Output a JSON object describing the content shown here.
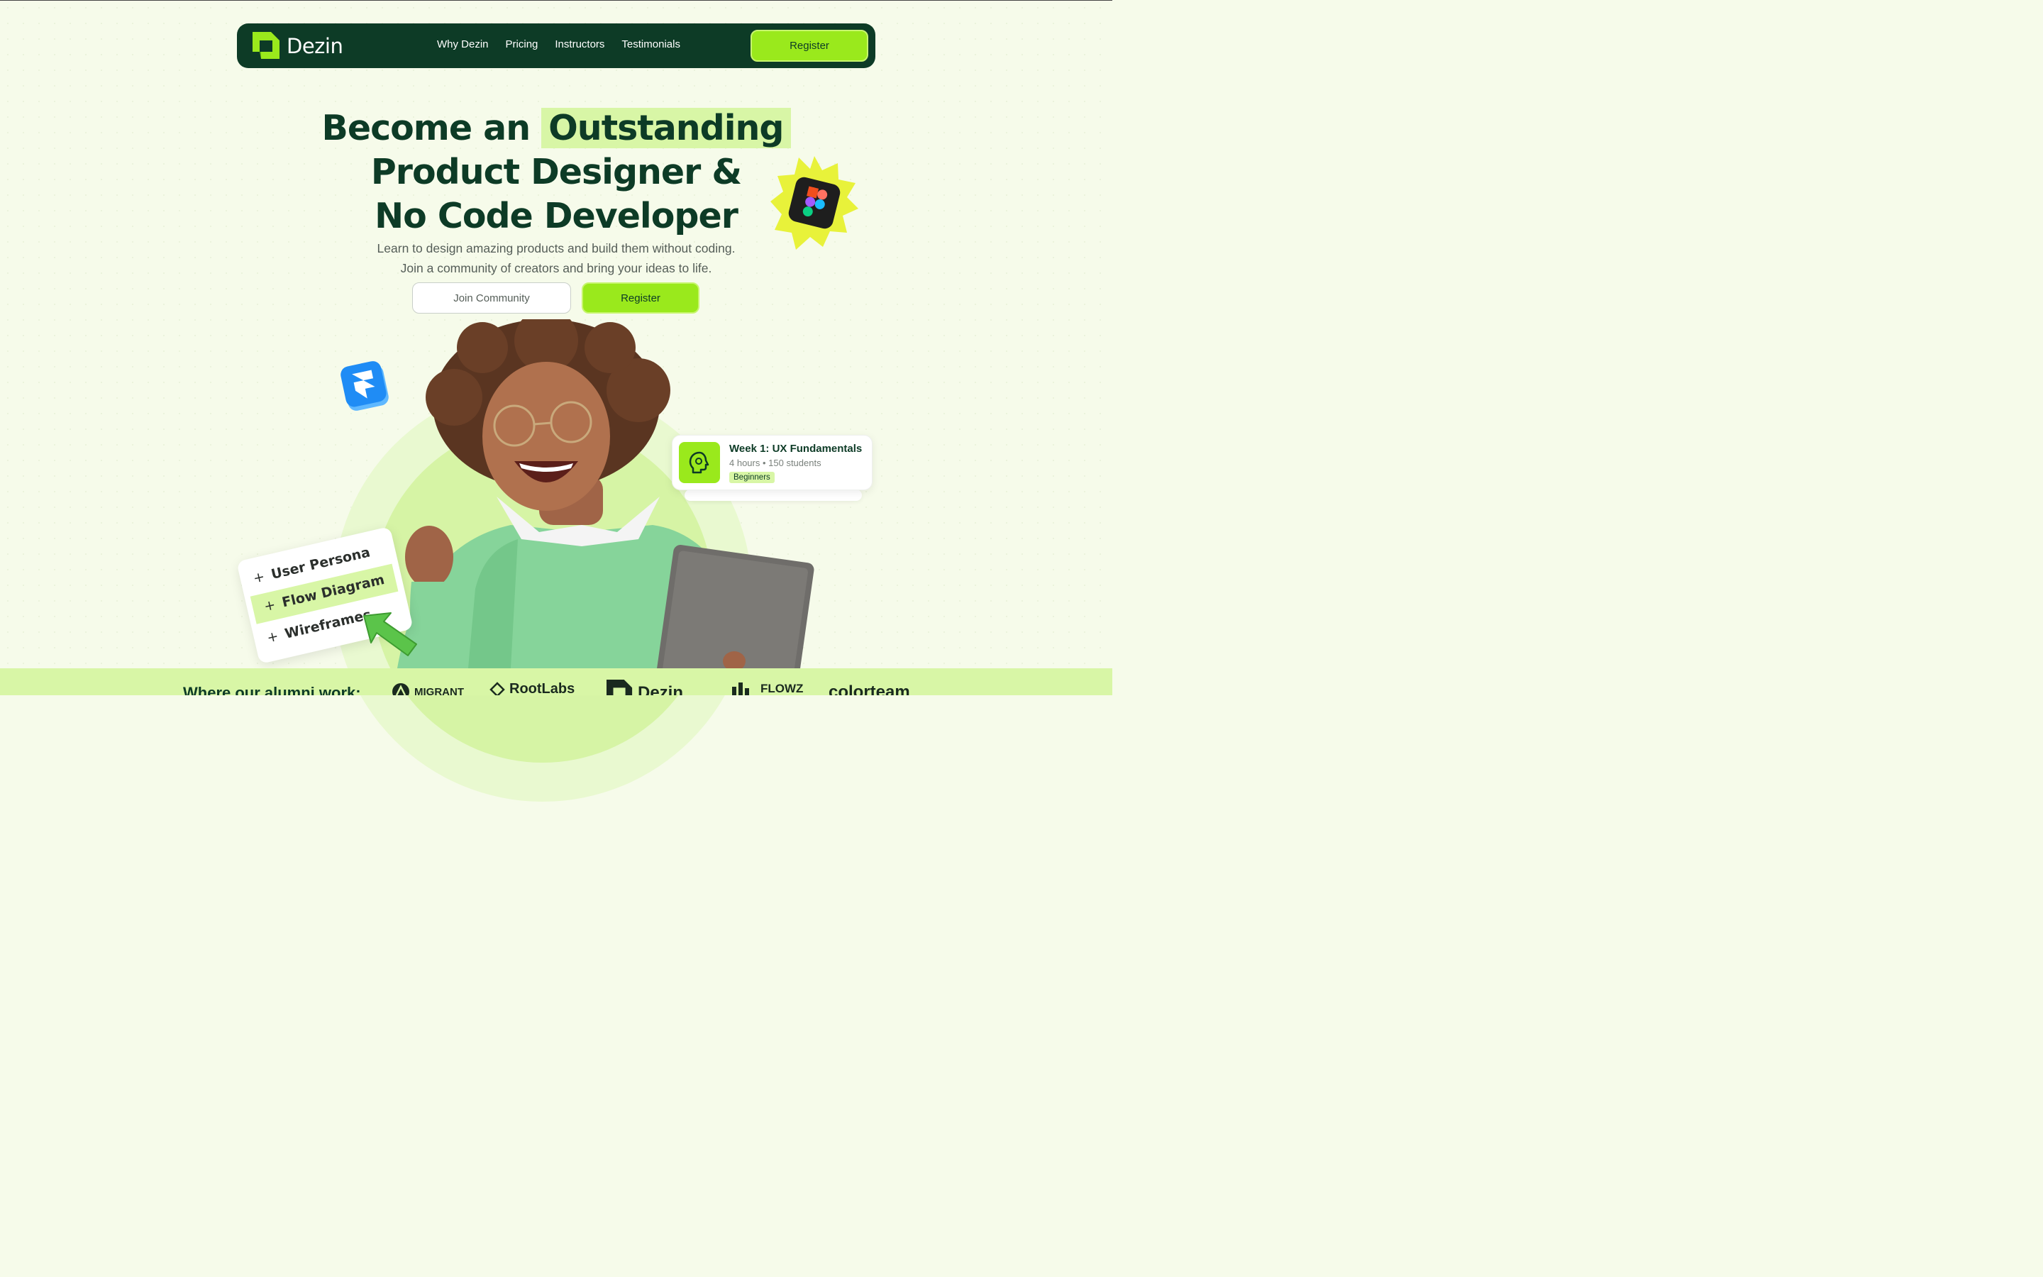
{
  "nav": {
    "brand": "Dezin",
    "links": [
      "Why Dezin",
      "Pricing",
      "Instructors",
      "Testimonials"
    ],
    "register_label": "Register"
  },
  "hero": {
    "title_line1_prefix": "Become an ",
    "title_highlight": "Outstanding",
    "title_line2": "Product Designer &",
    "title_line3": "No Code Developer",
    "subtitle_line1": "Learn to design amazing products and build them without coding.",
    "subtitle_line2": "Join a community of creators and bring your ideas to life.",
    "join_label": "Join Community",
    "register_label": "Register"
  },
  "course_card": {
    "title": "Week 1: UX Fundamentals",
    "meta": "4 hours • 150 students",
    "tag": "Beginners"
  },
  "checklist": {
    "items": [
      "User Persona",
      "Flow Diagram",
      "Wireframes"
    ]
  },
  "alumni": {
    "label": "Where our alumni work:",
    "logos": [
      "MIGRANT",
      "RootLabs",
      "Dezin",
      "FLOWZ",
      "colorteam"
    ]
  },
  "colors": {
    "brand_dark": "#0d3b26",
    "accent_green": "#9ae91c",
    "highlight": "#d8f6a6",
    "background": "#f6fbea"
  },
  "icons": [
    "dezin-logo-icon",
    "figma-icon",
    "framer-icon",
    "brain-gear-icon",
    "plus-icon",
    "cursor-arrow-icon"
  ]
}
